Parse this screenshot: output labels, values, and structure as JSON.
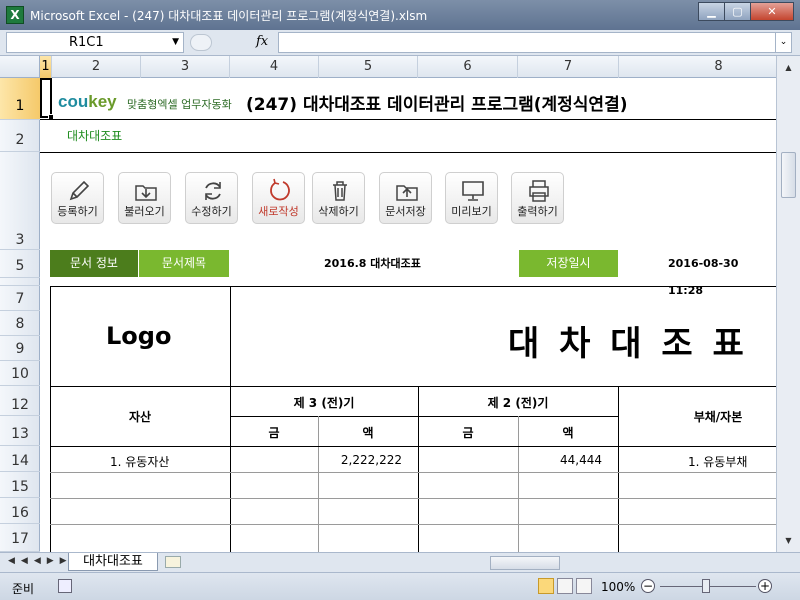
{
  "window": {
    "title": "Microsoft Excel - (247) 대차대조표 데이터관리 프로그램(계정식연결).xlsm",
    "minimize": "▁",
    "maximize": "▢",
    "close": "✕"
  },
  "formula_bar": {
    "name_box": "R1C1",
    "fx": "fx",
    "value": ""
  },
  "columns": [
    "1",
    "2",
    "3",
    "4",
    "5",
    "6",
    "7",
    "8"
  ],
  "rows": [
    "1",
    "2",
    "3",
    "5",
    "7",
    "8",
    "9",
    "10",
    "12",
    "13",
    "14",
    "15",
    "16",
    "17"
  ],
  "header": {
    "brand_cou": "cou",
    "brand_key": "key",
    "tagline": "맞춤형엑셀 업무자동화",
    "app_title": "(247) 대차대조표 데이터관리 프로그램(계정식연결)",
    "subtitle": "대차대조표"
  },
  "toolbar": [
    {
      "label": "등록하기",
      "icon": "pencil-icon"
    },
    {
      "label": "불러오기",
      "icon": "download-folder-icon"
    },
    {
      "label": "수정하기",
      "icon": "refresh-icon"
    },
    {
      "label": "새로작성",
      "icon": "new-circle-icon"
    },
    {
      "label": "삭제하기",
      "icon": "trash-icon"
    },
    {
      "label": "문서저장",
      "icon": "upload-folder-icon"
    },
    {
      "label": "미리보기",
      "icon": "monitor-icon"
    },
    {
      "label": "출력하기",
      "icon": "printer-icon"
    }
  ],
  "info": {
    "doc_info_label": "문서 정보",
    "doc_title_label": "문서제목",
    "doc_title_value": "2016.8 대차대조표",
    "saved_label": "저장일시",
    "saved_value": "2016-08-30 11:28"
  },
  "report": {
    "logo": "Logo",
    "title": "대 차 대 조 표",
    "col_asset": "자산",
    "period3": "제 3 (전)기",
    "period2": "제 2 (전)기",
    "col_liab": "부채/자본",
    "amt_a": "금",
    "amt_b": "액",
    "row1_asset": "1. 유동자산",
    "row1_p3_amount": "2,222,222",
    "row1_p2_amount": "44,444",
    "row1_liab": "1. 유동부채"
  },
  "sheet_tab": "대차대조표",
  "status": {
    "ready": "준비",
    "zoom": "100%"
  },
  "colors": {
    "dark_green": "#4c7d1c",
    "light_green": "#7ab82f",
    "title_bar": "#6f7f96"
  }
}
